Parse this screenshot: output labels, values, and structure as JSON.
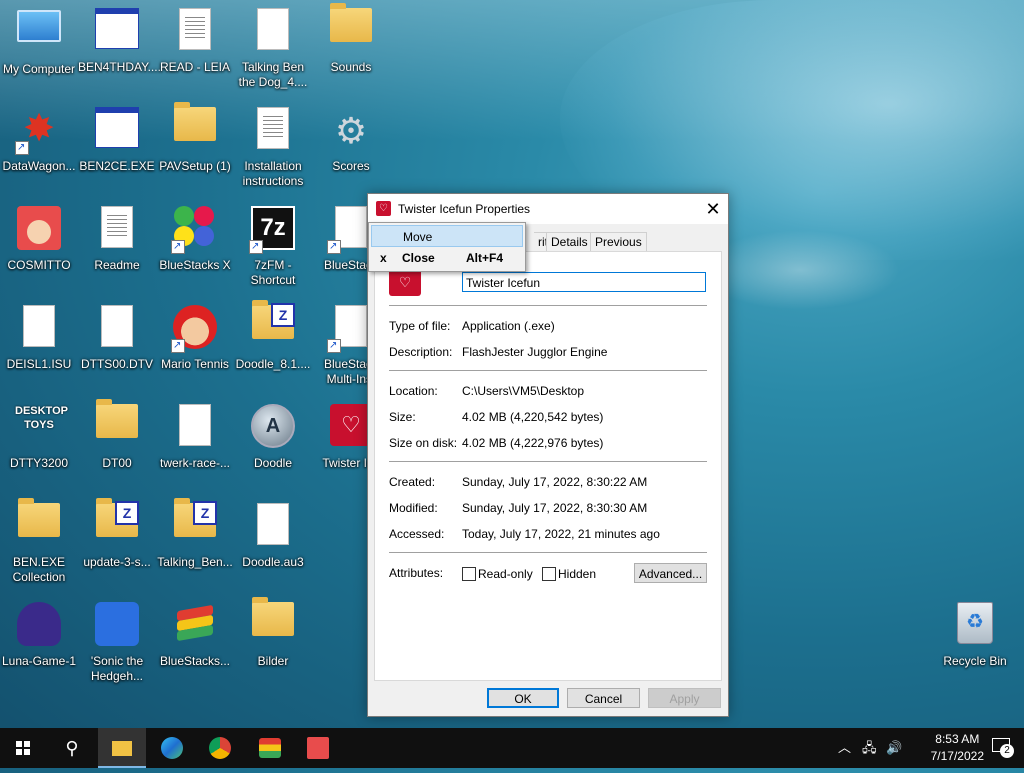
{
  "desktop": {
    "icons": [
      {
        "label": "My Computer",
        "name": "my-computer-icon"
      },
      {
        "label": "BEN4THDAY....",
        "name": "ben4thday-icon"
      },
      {
        "label": "READ - LEIA",
        "name": "read-leia-icon"
      },
      {
        "label": "Talking Ben the Dog_4....",
        "name": "talking-ben-file-icon"
      },
      {
        "label": "Sounds",
        "name": "sounds-folder-icon"
      },
      {
        "label": "DataWagon...",
        "name": "datawagon-icon"
      },
      {
        "label": "BEN2CE.EXE",
        "name": "ben2ce-icon"
      },
      {
        "label": "PAVSetup (1)",
        "name": "pavsetup-icon"
      },
      {
        "label": "Installation instructions",
        "name": "installation-instructions-icon"
      },
      {
        "label": "Scores",
        "name": "scores-icon"
      },
      {
        "label": "COSMITTO",
        "name": "cosmitto-icon"
      },
      {
        "label": "Readme",
        "name": "readme-icon"
      },
      {
        "label": "BlueStacks X",
        "name": "bluestacks-x-icon"
      },
      {
        "label": "7zFM - Shortcut",
        "name": "7zfm-shortcut-icon"
      },
      {
        "label": "BlueStack",
        "name": "bluestack-icon"
      },
      {
        "label": "DEISL1.ISU",
        "name": "deisl1-icon"
      },
      {
        "label": "DTTS00.DTV",
        "name": "dtts00-icon"
      },
      {
        "label": "Mario Tennis",
        "name": "mario-tennis-icon"
      },
      {
        "label": "Doodle_8.1....",
        "name": "doodle-zip-icon"
      },
      {
        "label": "BlueStack Multi-Inst",
        "name": "bluestack-multi-icon"
      },
      {
        "label": "DTTY3200",
        "name": "dtty3200-icon"
      },
      {
        "label": "DT00",
        "name": "dt00-folder-icon"
      },
      {
        "label": "twerk-race-...",
        "name": "twerk-race-icon"
      },
      {
        "label": "Doodle",
        "name": "doodle-icon"
      },
      {
        "label": "Twister Ice",
        "name": "twister-icefun-icon"
      },
      {
        "label": "BEN.EXE Collection",
        "name": "ben-exe-collection-icon"
      },
      {
        "label": "update-3-s...",
        "name": "update-3-icon"
      },
      {
        "label": "Talking_Ben...",
        "name": "talking-ben-zip-icon"
      },
      {
        "label": "Doodle.au3",
        "name": "doodle-au3-icon"
      },
      {
        "label": "Luna-Game-1",
        "name": "luna-game-icon"
      },
      {
        "label": "'Sonic the Hedgeh...",
        "name": "sonic-icon"
      },
      {
        "label": "BlueStacks...",
        "name": "bluestacks-icon"
      },
      {
        "label": "Bilder",
        "name": "bilder-folder-icon"
      },
      {
        "label": "Recycle Bin",
        "name": "recycle-bin-icon"
      }
    ]
  },
  "dialog": {
    "title": "Twister Icefun Properties",
    "close_glyph": "✕",
    "tabs": [
      "rity",
      "Details",
      "Previous Versions"
    ],
    "name_value": "Twister Icefun",
    "rows": {
      "type_label": "Type of file:",
      "type_value": "Application (.exe)",
      "desc_label": "Description:",
      "desc_value": "FlashJester Jugglor Engine",
      "loc_label": "Location:",
      "loc_value": "C:\\Users\\VM5\\Desktop",
      "size_label": "Size:",
      "size_value": "4.02 MB (4,220,542 bytes)",
      "disk_label": "Size on disk:",
      "disk_value": "4.02 MB (4,222,976 bytes)",
      "created_label": "Created:",
      "created_value": "Sunday, July 17, 2022, 8:30:22 AM",
      "modified_label": "Modified:",
      "modified_value": "Sunday, July 17, 2022, 8:30:30 AM",
      "accessed_label": "Accessed:",
      "accessed_value": "Today, July 17, 2022, 21 minutes ago",
      "attr_label": "Attributes:"
    },
    "readonly_label": "Read-only",
    "hidden_label": "Hidden",
    "advanced_label": "Advanced...",
    "ok_label": "OK",
    "cancel_label": "Cancel",
    "apply_label": "Apply"
  },
  "context_menu": {
    "move_label": "Move",
    "close_mark": "x",
    "close_label": "Close",
    "close_shortcut": "Alt+F4"
  },
  "taskbar": {
    "time": "8:53 AM",
    "date": "7/17/2022",
    "notification_count": "2"
  },
  "colors": {
    "accent": "#0078d7",
    "menu_highlight": "#cce4f7",
    "taskbar": "#101010"
  }
}
